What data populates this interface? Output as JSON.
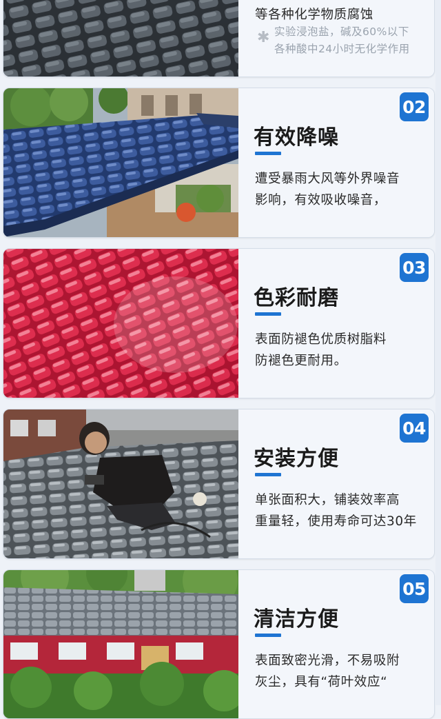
{
  "colors": {
    "accent": "#1e74d2",
    "card_bg": "#f3f6fb",
    "page_bg": "#eef2f8"
  },
  "card0": {
    "line_tail": "等各种化学物质腐蚀",
    "note_icon": "asterisk-icon",
    "note_lines": [
      "实验浸泡盐，碱及60%以下",
      "各种酸中24小时无化学作用"
    ]
  },
  "features": [
    {
      "number": "02",
      "title": "有效降噪",
      "lines": [
        "遭受暴雨大风等外界噪音",
        "影响，有效吸收噪音，"
      ]
    },
    {
      "number": "03",
      "title": "色彩耐磨",
      "lines": [
        "表面防褪色优质树脂料",
        "防褪色更耐用。"
      ]
    },
    {
      "number": "04",
      "title": "安装方便",
      "lines": [
        "单张面积大，铺装效率高",
        "重量轻，使用寿命可达30年"
      ]
    },
    {
      "number": "05",
      "title": "清洁方便",
      "lines": [
        "表面致密光滑，不易吸附",
        "灰尘，具有“荷叶效应“"
      ]
    }
  ]
}
